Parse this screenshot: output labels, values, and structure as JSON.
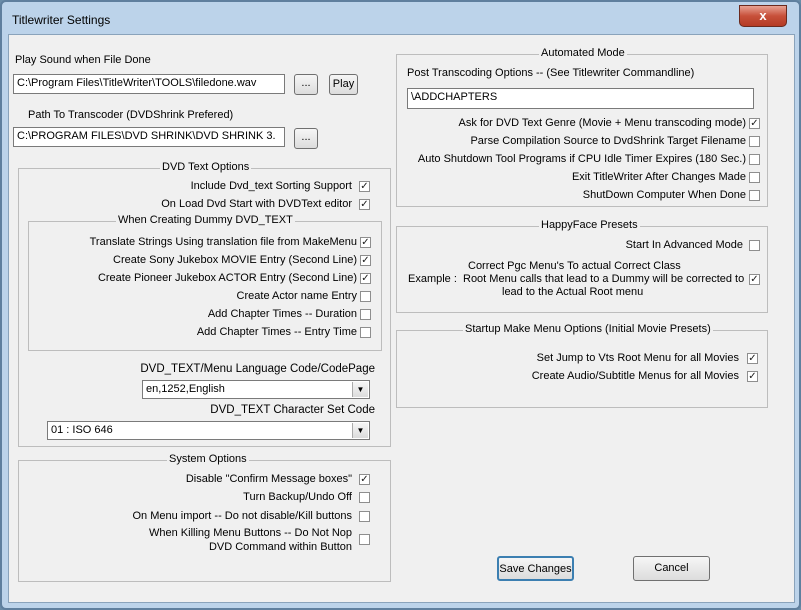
{
  "window": {
    "title": "Titlewriter Settings",
    "close_glyph": "x"
  },
  "play_sound": {
    "label": "Play Sound when File Done",
    "path": "C:\\Program Files\\TitleWriter\\TOOLS\\filedone.wav",
    "browse": "...",
    "play": "Play"
  },
  "transcoder": {
    "label": "Path To Transcoder (DVDShrink Prefered)",
    "path": "C:\\PROGRAM FILES\\DVD SHRINK\\DVD SHRINK 3.",
    "browse": "..."
  },
  "dvd_text_options": {
    "title": "DVD Text Options",
    "items": [
      {
        "label": "Include Dvd_text Sorting Support",
        "checked": true
      },
      {
        "label": "On Load Dvd Start with DVDText editor",
        "checked": true
      }
    ],
    "dummy": {
      "title": "When Creating Dummy DVD_TEXT",
      "items": [
        {
          "label": "Translate Strings Using translation file from MakeMenu",
          "checked": true
        },
        {
          "label": "Create Sony Jukebox MOVIE Entry (Second Line)",
          "checked": true
        },
        {
          "label": "Create Pioneer Jukebox ACTOR Entry (Second Line)",
          "checked": true
        },
        {
          "label": "Create Actor name Entry",
          "checked": false
        },
        {
          "label": "Add Chapter Times -- Duration",
          "checked": false
        },
        {
          "label": "Add Chapter Times -- Entry Time",
          "checked": false
        }
      ]
    },
    "lang_label": "DVD_TEXT/Menu Language Code/CodePage",
    "lang_value": "en,1252,English",
    "charset_label": "DVD_TEXT Character Set  Code",
    "charset_value": "01 : ISO 646"
  },
  "system_options": {
    "title": "System Options",
    "items": [
      {
        "label": "Disable \"Confirm Message boxes\"",
        "checked": true
      },
      {
        "label": "Turn Backup/Undo Off",
        "checked": false
      },
      {
        "label": "On Menu import -- Do not disable/Kill buttons",
        "checked": false
      }
    ],
    "nop_line1": "When Killing Menu Buttons -- Do Not Nop",
    "nop_line2": "DVD Command within Button",
    "nop_checked": false
  },
  "automated_mode": {
    "title": "Automated Mode",
    "post_label": "Post Transcoding Options -- (See Titlewriter Commandline)",
    "post_value": "\\ADDCHAPTERS",
    "items": [
      {
        "label": "Ask for DVD Text Genre (Movie + Menu transcoding mode)",
        "checked": true
      },
      {
        "label": "Parse Compilation Source to DvdShrink Target Filename",
        "checked": false
      },
      {
        "label": "Auto Shutdown Tool Programs if CPU Idle Timer Expires  (180 Sec.)",
        "checked": false
      },
      {
        "label": "Exit TitleWriter After Changes Made",
        "checked": false
      },
      {
        "label": "ShutDown Computer When Done",
        "checked": false
      }
    ]
  },
  "happyface": {
    "title": "HappyFace Presets",
    "advanced_label": "Start In Advanced Mode",
    "advanced_checked": false,
    "correct_line1": "Correct Pgc Menu's To actual Correct Class",
    "example_label": "Example :",
    "correct_line2": "Root Menu calls that lead to a Dummy will be corrected to",
    "correct_line3": "lead to the Actual Root menu",
    "correct_checked": true
  },
  "startup": {
    "title": "Startup Make Menu Options (Initial Movie Presets)",
    "items": [
      {
        "label": "Set  Jump to Vts Root Menu for all Movies",
        "checked": true
      },
      {
        "label": "Create Audio/Subtitle Menus for all Movies",
        "checked": true
      }
    ]
  },
  "actions": {
    "save": "Save Changes",
    "cancel": "Cancel"
  },
  "check_glyph": "✓",
  "combo_arrow": "▼"
}
